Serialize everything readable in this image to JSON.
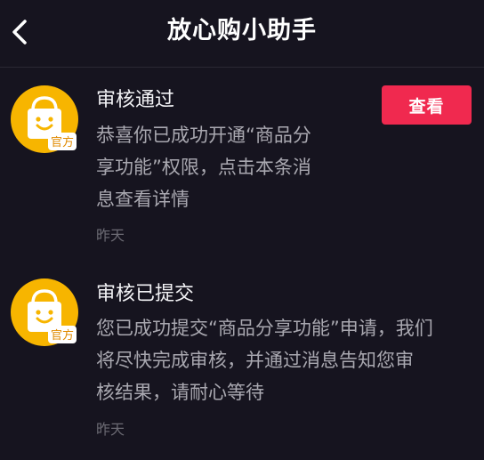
{
  "header": {
    "title": "放心购小助手",
    "back_icon": "chevron-left-icon"
  },
  "messages": [
    {
      "avatar_icon": "shopping-bag-smiley-icon",
      "avatar_tag": "官方",
      "title": "审核通过",
      "body_lines": [
        "恭喜你已成功开通“商品分",
        "享功能”权限，点击本条消",
        "息查看详情"
      ],
      "time": "昨天",
      "action_label": "查看"
    },
    {
      "avatar_icon": "shopping-bag-smiley-icon",
      "avatar_tag": "官方",
      "title": "审核已提交",
      "body_lines": [
        "您已成功提交“商品分享功能”申请，我们",
        "将尽快完成审核，并通过消息告知您审",
        "核结果，请耐心等待"
      ],
      "time": "昨天"
    }
  ],
  "colors": {
    "background": "#16141f",
    "accent": "#f0294f",
    "avatar_yellow": "#f7b500"
  }
}
